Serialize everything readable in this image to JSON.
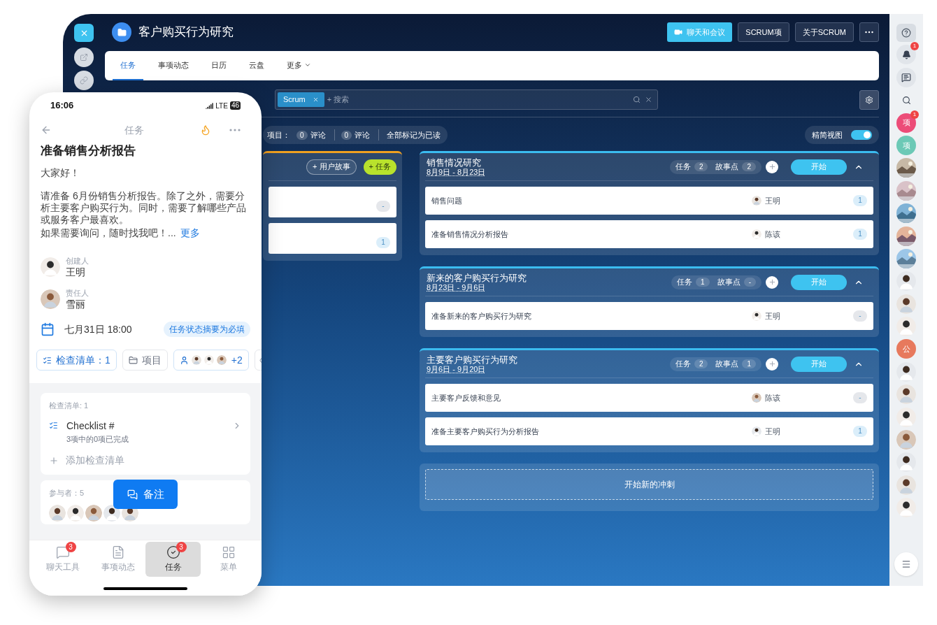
{
  "app": {
    "title": "客户购买行为研究",
    "header_buttons": [
      {
        "label": "聊天和会议",
        "kind": "primary"
      },
      {
        "label": "SCRUM项",
        "kind": "outline"
      },
      {
        "label": "关于SCRUM",
        "kind": "outline"
      }
    ],
    "tabs": [
      {
        "label": "任务",
        "selected": true
      },
      {
        "label": "事项动态",
        "selected": false
      },
      {
        "label": "日历",
        "selected": false
      },
      {
        "label": "云盘",
        "selected": false
      },
      {
        "label": "更多",
        "selected": false
      }
    ],
    "filter": {
      "tag": "Scrum",
      "placeholder": "+ 搜索"
    },
    "counters": {
      "label": "项目：",
      "items": [
        {
          "count": "0",
          "label": "评论"
        },
        {
          "count": "0",
          "label": "评论"
        }
      ],
      "mark_all": "全部标记为已读"
    },
    "compact_view": {
      "label": "精简视图",
      "on": true
    },
    "backlog": {
      "buttons": [
        {
          "label": "+ 用户故事",
          "kind": "outline"
        },
        {
          "label": "+ 任务",
          "kind": "lime"
        }
      ],
      "items": [
        {
          "points": "-",
          "color": "#e5e7eb"
        },
        {
          "points": "1",
          "color": "#dbeefa"
        }
      ]
    },
    "sprints": [
      {
        "title": "销售情况研究",
        "dates": "8月9日 - 8月23日",
        "tasks_label": "任务",
        "tasks": "2",
        "points_label": "故事点",
        "points": "2",
        "start": "开始",
        "expanded": true,
        "items": [
          {
            "name": "销售问题",
            "assignee": "王明",
            "points": "1",
            "color": "#dbeefa"
          },
          {
            "name": "准备销售情况分析报告",
            "assignee": "陈该",
            "points": "1",
            "color": "#dbeefa"
          }
        ]
      },
      {
        "title": "新来的客户购买行为研究",
        "dates": "8月23日 - 9月6日",
        "tasks_label": "任务",
        "tasks": "1",
        "points_label": "故事点",
        "points": "-",
        "start": "开始",
        "expanded": true,
        "items": [
          {
            "name": "准备新来的客户购买行为研究",
            "assignee": "王明",
            "points": "-",
            "color": "#e5e7eb"
          }
        ]
      },
      {
        "title": "主要客户购买行为研究",
        "dates": "9月6日 - 9月20日",
        "tasks_label": "任务",
        "tasks": "2",
        "points_label": "故事点",
        "points": "1",
        "start": "开始",
        "expanded": true,
        "items": [
          {
            "name": "主要客户反馈和意见",
            "assignee": "陈该",
            "points": "-",
            "color": "#e5e7eb"
          },
          {
            "name": "准备主要客户购买行为分析报告",
            "assignee": "王明",
            "points": "1",
            "color": "#dbeefa"
          }
        ]
      }
    ],
    "new_sprint": "开始新的冲刺",
    "sidebar": [
      {
        "kind": "help"
      },
      {
        "kind": "bell",
        "badge": "1"
      },
      {
        "kind": "chat"
      },
      {
        "kind": "search"
      },
      {
        "kind": "letter",
        "label": "项",
        "color": "#ec4c78",
        "badge": "1"
      },
      {
        "kind": "letter",
        "label": "项",
        "color": "#6cc9b6"
      },
      {
        "kind": "picture"
      },
      {
        "kind": "picture"
      },
      {
        "kind": "picture"
      },
      {
        "kind": "picture"
      },
      {
        "kind": "picture"
      },
      {
        "kind": "person"
      },
      {
        "kind": "person"
      },
      {
        "kind": "person"
      },
      {
        "kind": "letter",
        "label": "公",
        "color": "#e7795d"
      },
      {
        "kind": "person"
      },
      {
        "kind": "person"
      },
      {
        "kind": "person"
      },
      {
        "kind": "person"
      },
      {
        "kind": "person"
      },
      {
        "kind": "person"
      },
      {
        "kind": "person"
      },
      {
        "kind": "menu"
      }
    ]
  },
  "phone": {
    "time": "16:06",
    "network": "LTE",
    "battery": "46",
    "header_title": "任务",
    "task_title": "准备销售分析报告",
    "greeting": "大家好！",
    "paragraph": "请准备 6月份销售分析报告。除了之外，需要分析主要客户购买行为。同时，需要了解哪些产品或服务客户最喜欢。",
    "last_line": "如果需要询问，随时找我吧！...",
    "more": "更多",
    "people": [
      {
        "role": "创建人",
        "name": "王明"
      },
      {
        "role": "责任人",
        "name": "雪丽"
      }
    ],
    "deadline": "七月31日 18:00",
    "deadline_tag": "任务状态摘要为必填",
    "chips": [
      {
        "kind": "checklist",
        "label": "检查清单：1"
      },
      {
        "kind": "project",
        "label": "项目"
      },
      {
        "kind": "members",
        "label": "+2"
      },
      {
        "kind": "watch"
      }
    ],
    "checklist": {
      "heading": "检查清单: 1",
      "items": [
        {
          "name": "Checklist #",
          "progress": "3项中的0项已完成"
        }
      ],
      "add": "添加检查清单"
    },
    "participants": {
      "heading": "参与者：5"
    },
    "comment_button": "备注",
    "nav": [
      {
        "kind": "chat",
        "label": "聊天工具",
        "badge": "3",
        "selected": false
      },
      {
        "kind": "feed",
        "label": "事项动态",
        "selected": false
      },
      {
        "kind": "task",
        "label": "任务",
        "badge": "3",
        "selected": true
      },
      {
        "kind": "menu",
        "label": "菜单",
        "selected": false
      }
    ]
  }
}
